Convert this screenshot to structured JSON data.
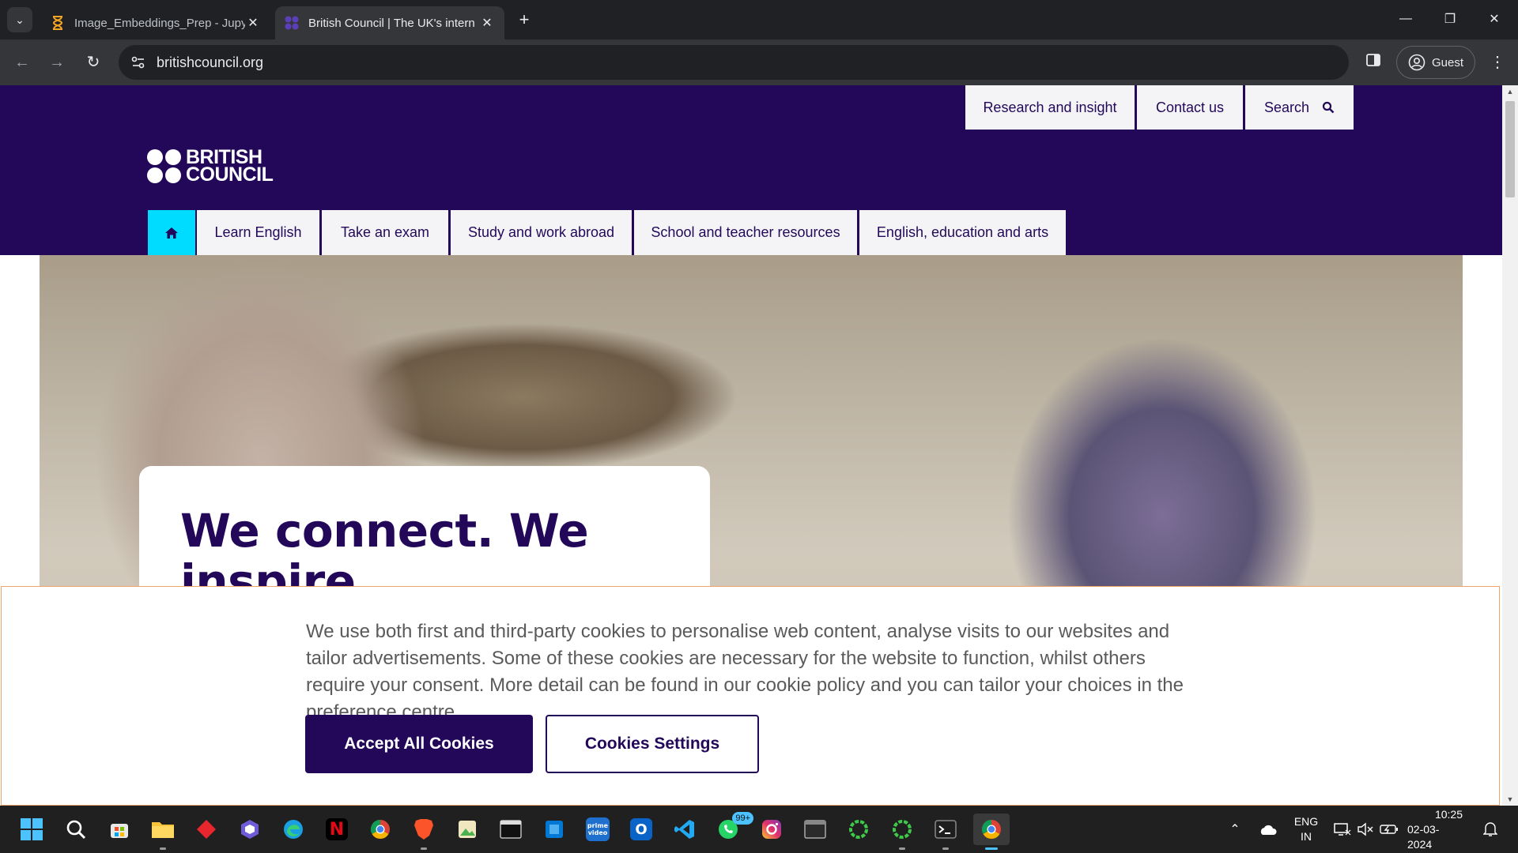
{
  "browser": {
    "tabs": [
      {
        "title": "Image_Embeddings_Prep - Jupy",
        "favicon": "hourglass-icon",
        "active": false
      },
      {
        "title": "British Council | The UK's intern",
        "favicon": "british-council-icon",
        "active": true
      }
    ],
    "url": "britishcouncil.org",
    "profile_label": "Guest"
  },
  "site": {
    "logo": {
      "line1": "BRITISH",
      "line2": "COUNCIL"
    },
    "utility_links": [
      "Research and insight",
      "Contact us",
      "Search"
    ],
    "main_nav": [
      "Learn English",
      "Take an exam",
      "Study and work abroad",
      "School and teacher resources",
      "English, education and arts"
    ],
    "hero_heading": "We connect. We inspire.",
    "colors": {
      "brand_purple": "#23085a",
      "home_cyan": "#00dcff",
      "cookie_border": "#f0a46c"
    }
  },
  "cookie_banner": {
    "text": "We use both first and third-party cookies to personalise web content, analyse visits to our websites and tailor advertisements. Some of these cookies are necessary for the website to function, whilst others require your consent. More detail can be found in our cookie policy and you can tailor your choices in the preference centre.",
    "accept_label": "Accept All Cookies",
    "settings_label": "Cookies Settings"
  },
  "taskbar": {
    "icons": [
      "windows-start-icon",
      "search-icon",
      "microsoft-store-icon",
      "file-explorer-icon",
      "red-diamond-app-icon",
      "copilot-icon",
      "edge-icon",
      "netflix-icon",
      "chrome-icon",
      "brave-icon",
      "image-viewer-icon",
      "terminal-window-icon",
      "windows-app-icon",
      "prime-video-icon",
      "outlook-icon",
      "vscode-icon",
      "whatsapp-icon",
      "instagram-icon",
      "console-window-icon",
      "green-ring-app-icon",
      "green-ring-app-2-icon",
      "terminal-icon",
      "chrome-active-icon"
    ],
    "whatsapp_badge": "99+",
    "netflix_glyph": "N",
    "prime_glyph": "prime video",
    "outlook_glyph": "O",
    "language": {
      "line1": "ENG",
      "line2": "IN"
    },
    "time": "10:25",
    "date": "02-03-2024"
  }
}
